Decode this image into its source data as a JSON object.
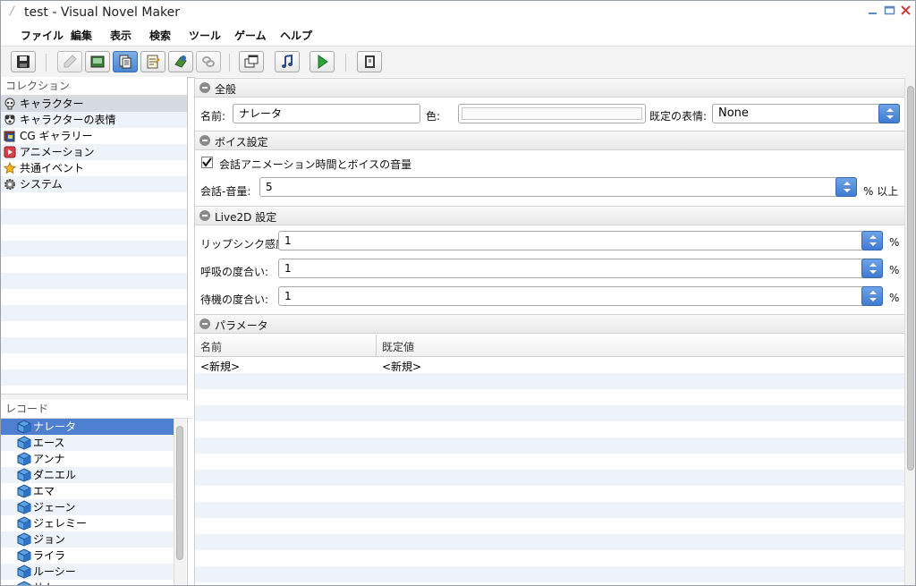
{
  "window": {
    "title": "test - Visual Novel Maker"
  },
  "menu": [
    "ファイル",
    "編集",
    "表示",
    "検索",
    "ツール",
    "ゲーム",
    "ヘルプ"
  ],
  "toolbar": {
    "icons": [
      "save-icon",
      "pen-icon",
      "image-icon",
      "database-icon",
      "script-icon",
      "plugin-icon",
      "chain-icon",
      "windows-icon",
      "music-note-icon",
      "play-icon",
      "book-icon"
    ],
    "active": "database-icon"
  },
  "collection": {
    "header": "コレクション",
    "items": [
      {
        "label": "キャラクター",
        "icon": "skull-icon",
        "selected": true
      },
      {
        "label": "キャラクターの表情",
        "icon": "face-icon",
        "selected": false
      },
      {
        "label": "CG ギャラリー",
        "icon": "gallery-icon",
        "selected": false
      },
      {
        "label": "アニメーション",
        "icon": "animation-icon",
        "selected": false
      },
      {
        "label": "共通イベント",
        "icon": "star-icon",
        "selected": false
      },
      {
        "label": "システム",
        "icon": "gear-icon",
        "selected": false
      }
    ]
  },
  "records": {
    "header": "レコード",
    "items": [
      "ナレータ",
      "エース",
      "アンナ",
      "ダニエル",
      "エマ",
      "ジェーン",
      "ジェレミー",
      "ジョン",
      "ライラ",
      "ルーシー",
      "サム"
    ],
    "selected_index": 0
  },
  "general": {
    "title": "全般",
    "name_label": "名前:",
    "name_value": "ナレータ",
    "color_label": "色:",
    "default_expression_label": "既定の表情:",
    "default_expression_value": "None"
  },
  "voice": {
    "title": "ボイス設定",
    "checkbox_label": "会話アニメーション時間とボイスの音量",
    "checked": true,
    "volume_label": "会話-音量:",
    "volume_value": "5",
    "volume_suffix": "% 以上"
  },
  "live2d": {
    "title": "Live2D 設定",
    "rows": [
      {
        "label": "リップシンク感度:",
        "value": "1",
        "suffix": "%"
      },
      {
        "label": "呼吸の度合い:",
        "value": "1",
        "suffix": "%"
      },
      {
        "label": "待機の度合い:",
        "value": "1",
        "suffix": "%"
      }
    ]
  },
  "params": {
    "title": "パラメータ",
    "columns": [
      "名前",
      "既定値"
    ],
    "rows": [
      [
        "<新規>",
        "<新規>"
      ]
    ]
  },
  "colors": {
    "accent": "#4f7fd0",
    "spin": "#3f7bd1",
    "selected_row": "#d6dbe2"
  }
}
